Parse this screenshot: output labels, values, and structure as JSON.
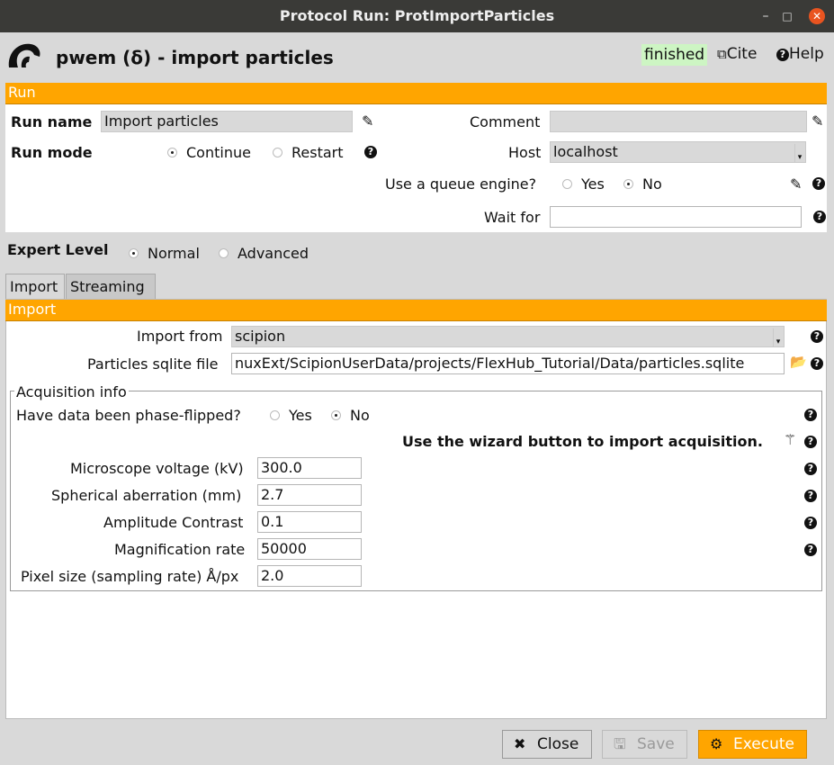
{
  "window": {
    "title": "Protocol Run: ProtImportParticles"
  },
  "header": {
    "app_title": "pwem (δ) - import particles",
    "status": "finished",
    "cite_label": "Cite",
    "help_label": "Help"
  },
  "run": {
    "section_title": "Run",
    "run_name_label": "Run name",
    "run_name_value": "Import particles",
    "comment_label": "Comment",
    "comment_value": "",
    "run_mode_label": "Run mode",
    "run_mode_options": [
      "Continue",
      "Restart"
    ],
    "run_mode_selected": "Continue",
    "host_label": "Host",
    "host_value": "localhost",
    "queue_label": "Use a queue engine?",
    "queue_options": [
      "Yes",
      "No"
    ],
    "queue_selected": "No",
    "wait_for_label": "Wait for",
    "wait_for_value": ""
  },
  "expert": {
    "label": "Expert Level",
    "options": [
      "Normal",
      "Advanced"
    ],
    "selected": "Normal"
  },
  "tabs": [
    {
      "label": "Import",
      "active": true
    },
    {
      "label": "Streaming",
      "active": false
    }
  ],
  "import": {
    "section_title": "Import",
    "import_from_label": "Import from",
    "import_from_value": "scipion",
    "sqlite_label": "Particles sqlite file",
    "sqlite_value": "nuxExt/ScipionUserData/projects/FlexHub_Tutorial/Data/particles.sqlite"
  },
  "acquisition": {
    "group_title": "Acquisition info",
    "phase_flipped_label": "Have data been phase-flipped?",
    "phase_flipped_options": [
      "Yes",
      "No"
    ],
    "phase_flipped_selected": "No",
    "wizard_text": "Use the wizard button to import acquisition.",
    "voltage_label": "Microscope voltage (kV)",
    "voltage_value": "300.0",
    "spherical_label": "Spherical aberration (mm)",
    "spherical_value": "2.7",
    "amplitude_label": "Amplitude Contrast",
    "amplitude_value": "0.1",
    "magnification_label": "Magnification rate",
    "magnification_value": "50000",
    "pixel_label": "Pixel size (sampling rate) Å/px",
    "pixel_value": "2.0"
  },
  "footer": {
    "close_label": "Close",
    "save_label": "Save",
    "execute_label": "Execute"
  },
  "colors": {
    "accent": "#ffa500",
    "status_bg": "#cdf5c3",
    "titlebar": "#3a3a37",
    "close_button": "#e95420"
  }
}
